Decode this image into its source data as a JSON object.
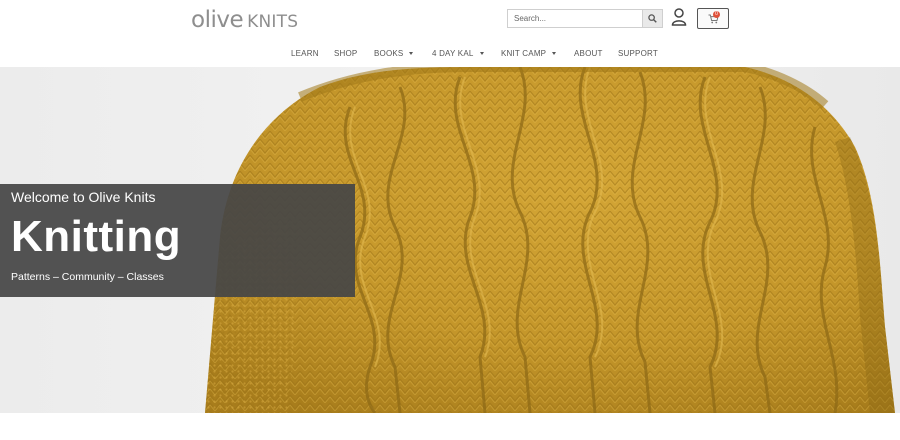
{
  "header": {
    "logo": {
      "word1": "olive",
      "word2": "KNITS"
    },
    "search": {
      "placeholder": "Search..."
    },
    "cart_count": "0"
  },
  "nav": {
    "items": [
      {
        "label": "LEARN",
        "dropdown": false
      },
      {
        "label": "SHOP",
        "dropdown": false
      },
      {
        "label": "BOOKS",
        "dropdown": true
      },
      {
        "label": "4 DAY KAL",
        "dropdown": true
      },
      {
        "label": "KNIT CAMP",
        "dropdown": true
      },
      {
        "label": "ABOUT",
        "dropdown": false
      },
      {
        "label": "SUPPORT",
        "dropdown": false
      }
    ]
  },
  "hero": {
    "welcome": "Welcome to Olive Knits",
    "title": "Knitting",
    "subtitle": "Patterns – Community – Classes"
  },
  "colors": {
    "sweater": "#c89a2c",
    "sweater_dark": "#8a6615",
    "overlay": "#464646",
    "badge": "#e0513a"
  },
  "icons": [
    "search-icon",
    "user-icon",
    "cart-icon",
    "chevron-down-icon"
  ]
}
